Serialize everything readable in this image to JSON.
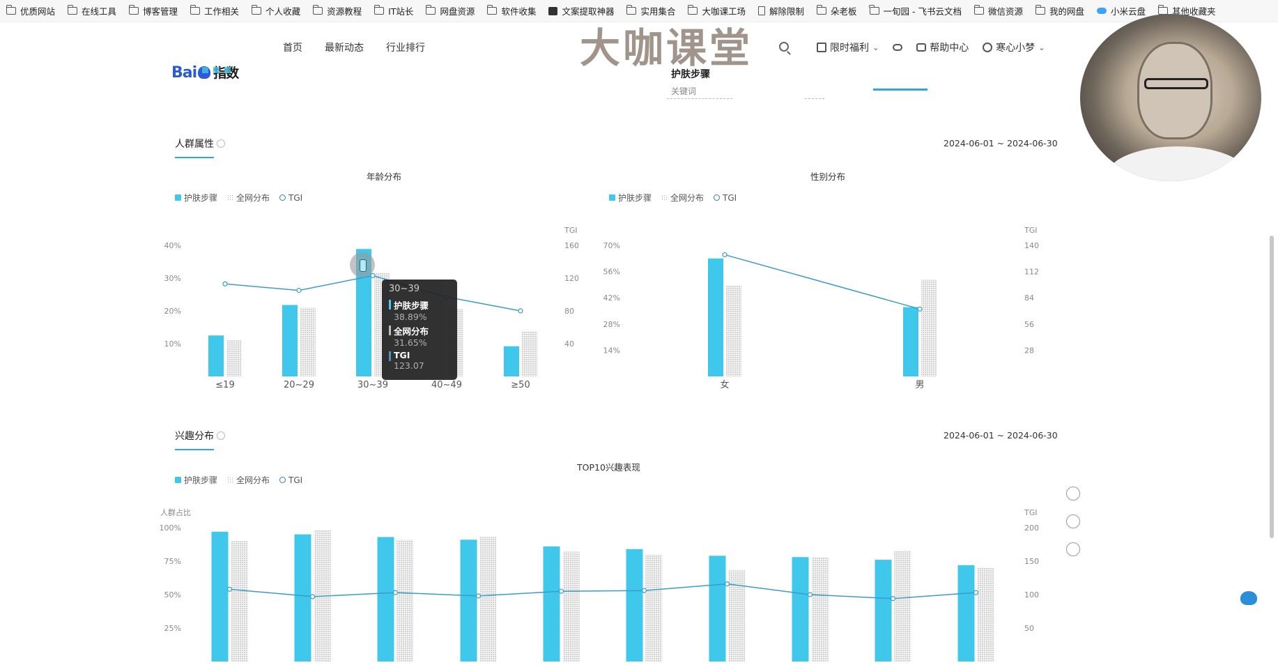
{
  "bookmarks": [
    "优质网站",
    "在线工具",
    "博客管理",
    "工作相关",
    "个人收藏",
    "资源教程",
    "IT站长",
    "网盘资源",
    "软件收集",
    "文案提取神器",
    "实用集合",
    "大咖课工场",
    "解除限制",
    "朵老板",
    "一旬园 - 飞书云文档",
    "微信资源",
    "我的网盘",
    "小米云盘",
    "其他收藏夹"
  ],
  "header": {
    "logo": "Bai",
    "logo_suffix": "指数",
    "nav": [
      "首页",
      "最新动态",
      "行业排行"
    ],
    "watermark": "大咖课堂",
    "user_menu": [
      "限时福利",
      "",
      "帮助中心",
      "寒心小梦"
    ],
    "keyword": "护肤步骤",
    "keyword_sub": "关键词"
  },
  "sections": {
    "crowd": {
      "title": "人群属性",
      "date": "2024-06-01 ~ 2024-06-30"
    },
    "interest": {
      "title": "兴趣分布",
      "date": "2024-06-01 ~ 2024-06-30"
    }
  },
  "legend": {
    "series_a": "护肤步骤",
    "series_b": "全网分布",
    "series_c": "TGI"
  },
  "tooltip": {
    "category": "30~39",
    "rows": [
      {
        "name": "护肤步骤",
        "value": "38.89%"
      },
      {
        "name": "全网分布",
        "value": "31.65%"
      },
      {
        "name": "TGI",
        "value": "123.07"
      }
    ]
  },
  "colors": {
    "accent": "#3fc8ec",
    "tgi": "#3a8fc0",
    "dots": "#b0b0b0"
  },
  "chart_data": [
    {
      "type": "bar",
      "title": "年龄分布",
      "categories": [
        "≤19",
        "20~29",
        "30~39",
        "40~49",
        "≥50"
      ],
      "series": [
        {
          "name": "护肤步骤",
          "values": [
            12.5,
            21.8,
            38.89,
            0,
            9.2
          ]
        },
        {
          "name": "全网分布",
          "values": [
            11.0,
            21.0,
            31.65,
            20.5,
            13.8
          ]
        },
        {
          "name": "TGI",
          "values": [
            113,
            105,
            123.07,
            97,
            80
          ]
        }
      ],
      "y_left_ticks": [
        "10%",
        "20%",
        "30%",
        "40%"
      ],
      "y_right_label": "TGI",
      "y_right_ticks": [
        "40",
        "80",
        "120",
        "160"
      ],
      "ylim_left": [
        0,
        40
      ],
      "ylim_right": [
        0,
        160
      ]
    },
    {
      "type": "bar",
      "title": "性别分布",
      "categories": [
        "女",
        "男"
      ],
      "series": [
        {
          "name": "护肤步骤",
          "values": [
            63,
            37
          ]
        },
        {
          "name": "全网分布",
          "values": [
            48.5,
            51.5
          ]
        },
        {
          "name": "TGI",
          "values": [
            130,
            72
          ]
        }
      ],
      "y_left_ticks": [
        "14%",
        "28%",
        "42%",
        "56%",
        "70%"
      ],
      "y_right_label": "TGI",
      "y_right_ticks": [
        "28",
        "56",
        "84",
        "112",
        "140"
      ],
      "ylim_left": [
        0,
        70
      ],
      "ylim_right": [
        0,
        140
      ]
    },
    {
      "type": "bar",
      "title": "TOP10兴趣表现",
      "ylabel": "人群占比",
      "categories": [
        "",
        "",
        "",
        "",
        "",
        "",
        "",
        "",
        "",
        ""
      ],
      "series": [
        {
          "name": "护肤步骤",
          "values": [
            97,
            95,
            93,
            91,
            86,
            84,
            79,
            78,
            76,
            72
          ]
        },
        {
          "name": "全网分布",
          "values": [
            90,
            98,
            91,
            93,
            82,
            80,
            68,
            78,
            83,
            70
          ]
        },
        {
          "name": "TGI",
          "values": [
            108,
            97,
            103,
            98,
            105,
            106,
            116,
            100,
            94,
            103
          ]
        }
      ],
      "y_left_ticks": [
        "25%",
        "50%",
        "75%",
        "100%"
      ],
      "y_right_label": "TGI",
      "y_right_ticks": [
        "50",
        "100",
        "150",
        "200"
      ],
      "ylim_left": [
        0,
        100
      ],
      "ylim_right": [
        0,
        200
      ]
    }
  ]
}
